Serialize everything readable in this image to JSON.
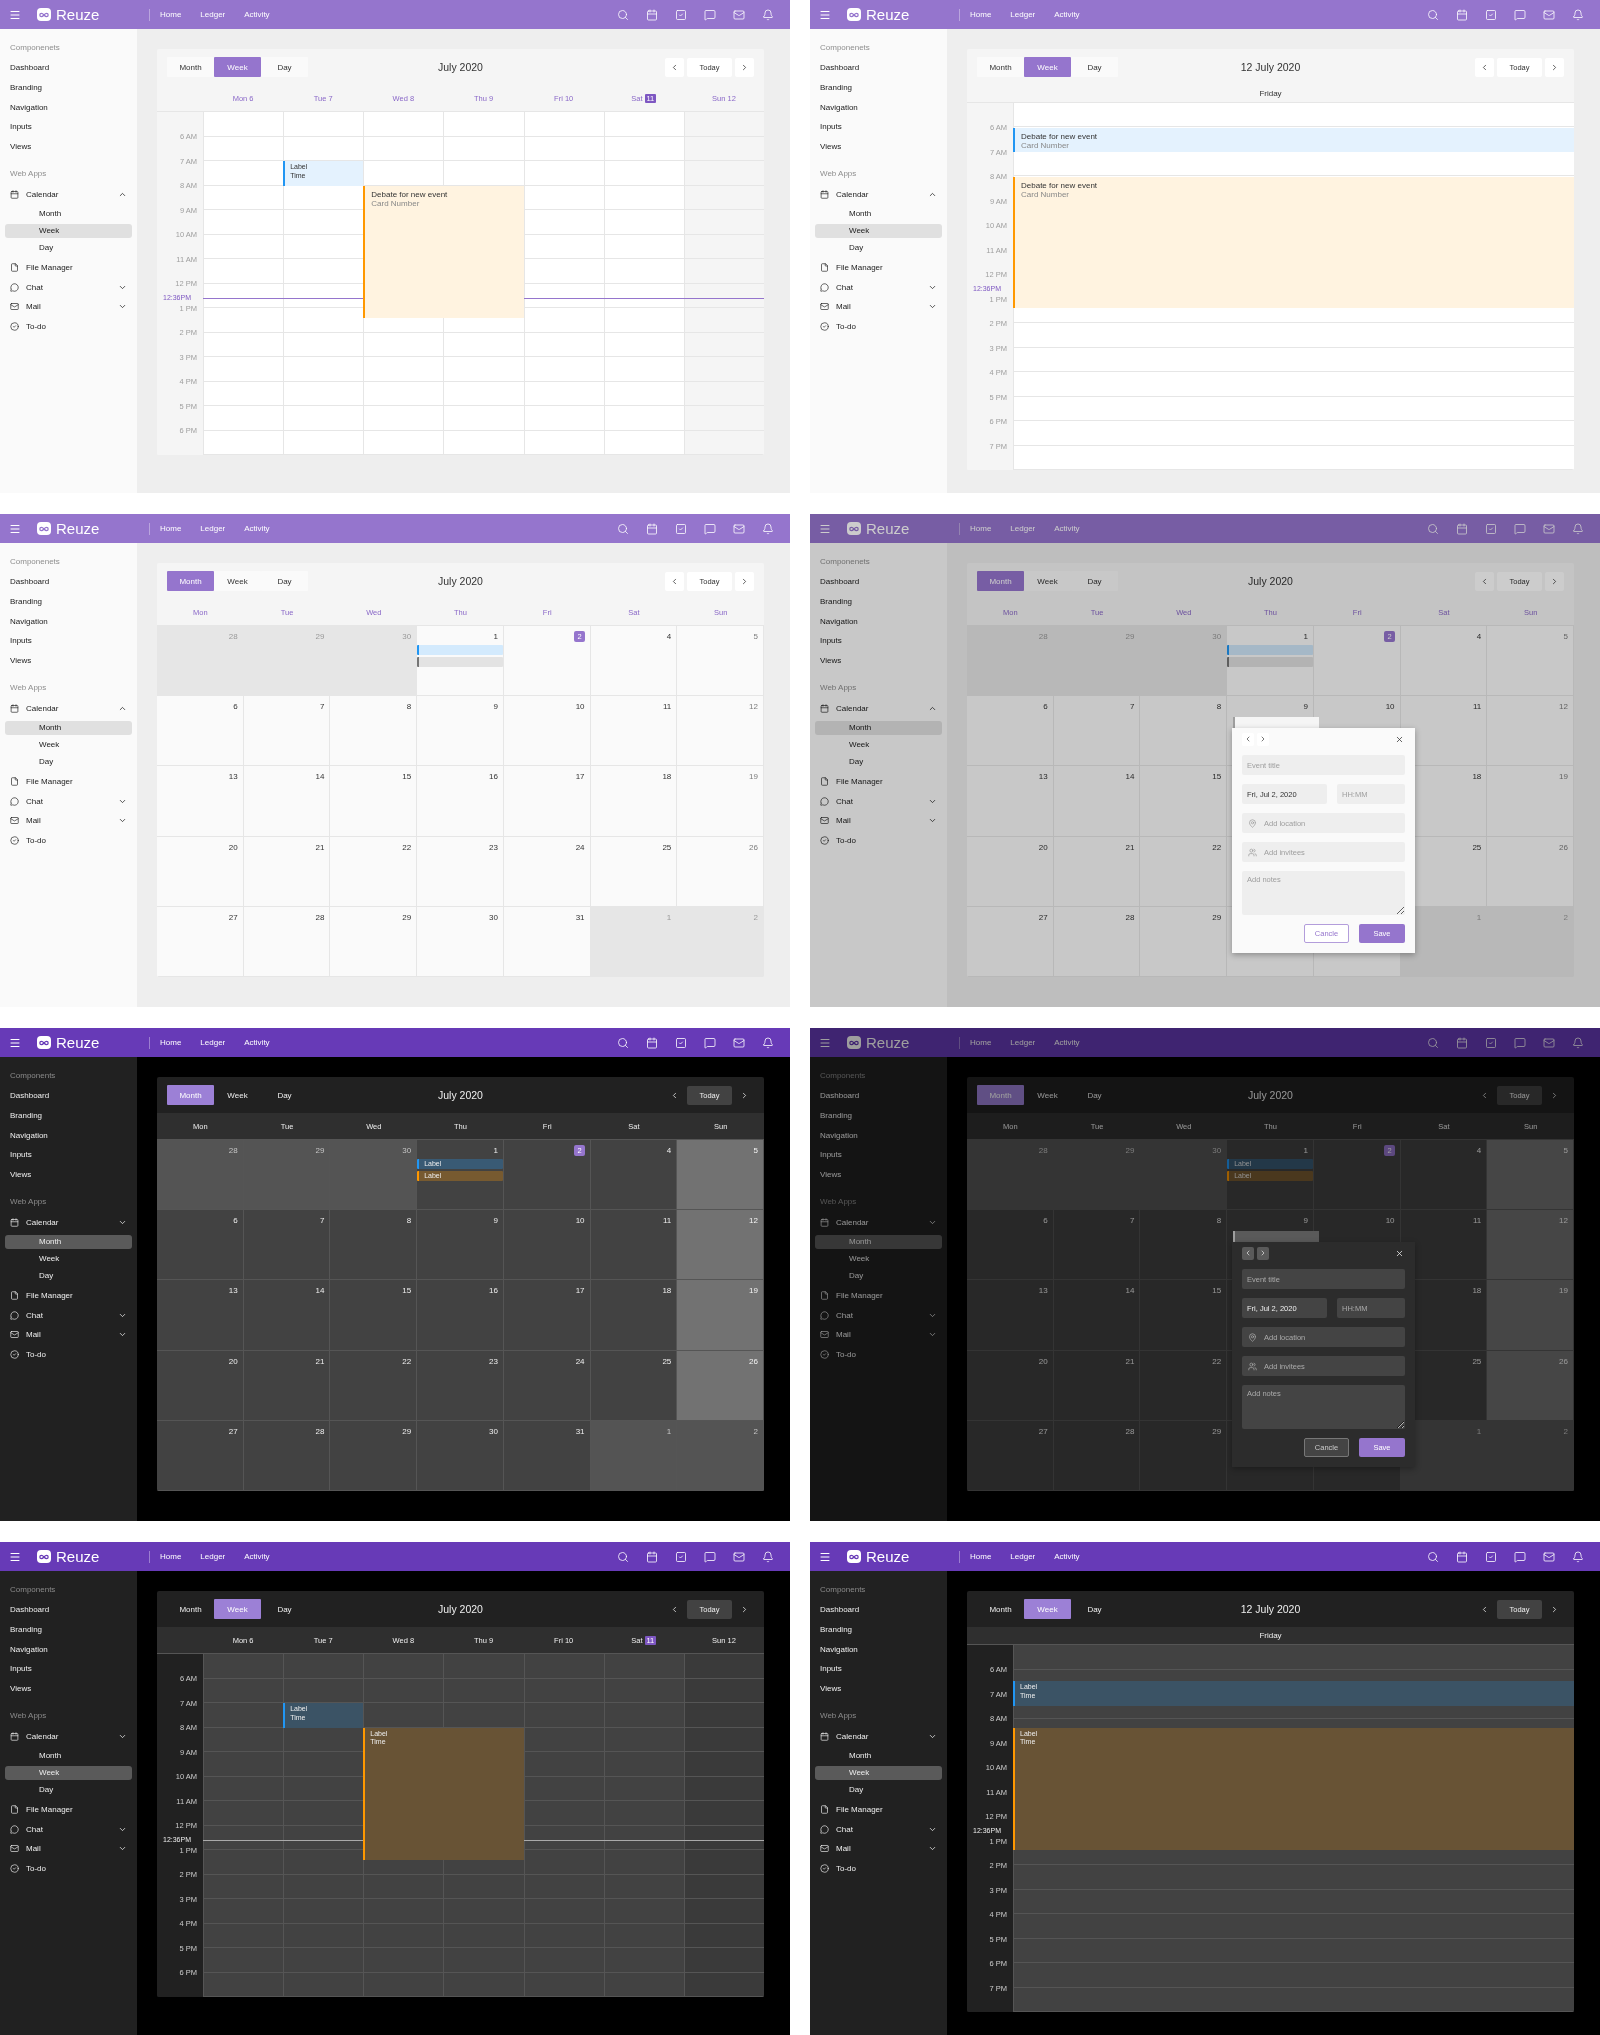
{
  "screens": [
    {
      "dark": false,
      "dimmed": false,
      "kind": "week",
      "topbar": {
        "brand": "Reuze",
        "links": [
          "Home",
          "Ledger",
          "Activity"
        ]
      },
      "sidebar": {
        "sections": [
          {
            "title": "Componenets",
            "items": [
              {
                "label": "Dashboard"
              },
              {
                "label": "Branding"
              },
              {
                "label": "Navigation"
              },
              {
                "label": "Inputs"
              },
              {
                "label": "Views"
              }
            ]
          },
          {
            "title": "Web Apps",
            "items": [
              {
                "label": "Calendar",
                "expanded": true,
                "children": [
                  {
                    "label": "Month",
                    "selected": false
                  },
                  {
                    "label": "Week",
                    "selected": true
                  },
                  {
                    "label": "Day",
                    "selected": false
                  }
                ]
              },
              {
                "label": "File Manager"
              },
              {
                "label": "Chat",
                "expanded": false
              },
              {
                "label": "Mail",
                "expanded": false
              },
              {
                "label": "To-do"
              }
            ]
          }
        ]
      },
      "toolbar": {
        "views": [
          {
            "label": "Month",
            "selected": false
          },
          {
            "label": "Week",
            "selected": true
          },
          {
            "label": "Day",
            "selected": false
          }
        ],
        "title": "July 2020",
        "today": "Today"
      },
      "days": [
        {
          "label": "Mon 6"
        },
        {
          "label": "Tue 7"
        },
        {
          "label": "Wed 8"
        },
        {
          "label": "Thu 9"
        },
        {
          "label": "Fri 10"
        },
        {
          "label": "Sat",
          "badge": "11"
        },
        {
          "label": "Sun 12"
        }
      ],
      "hours": [
        "6 AM",
        "7 AM",
        "8 AM",
        "9 AM",
        "10 AM",
        "11 AM",
        "12 PM",
        "1 PM",
        "2 PM",
        "3 PM",
        "4 PM",
        "5 PM",
        "6 PM"
      ],
      "now_label": "12:36PM",
      "events": [
        {
          "title": "Label",
          "subtitle": "Time",
          "color": "#2196f3"
        },
        {
          "title": "Debate for new event",
          "subtitle": "Card Number",
          "color": "#ff9800"
        }
      ]
    },
    {
      "dark": false,
      "dimmed": false,
      "kind": "day",
      "topbar": {
        "brand": "Reuze",
        "links": [
          "Home",
          "Ledger",
          "Activity"
        ]
      },
      "sidebar": {
        "sections": [
          {
            "title": "Componenets",
            "items": [
              {
                "label": "Dashboard"
              },
              {
                "label": "Branding"
              },
              {
                "label": "Navigation"
              },
              {
                "label": "Inputs"
              },
              {
                "label": "Views"
              }
            ]
          },
          {
            "title": "Web Apps",
            "items": [
              {
                "label": "Calendar",
                "expanded": true,
                "children": [
                  {
                    "label": "Month",
                    "selected": false
                  },
                  {
                    "label": "Week",
                    "selected": true
                  },
                  {
                    "label": "Day",
                    "selected": false
                  }
                ]
              },
              {
                "label": "File Manager"
              },
              {
                "label": "Chat",
                "expanded": false
              },
              {
                "label": "Mail",
                "expanded": false
              },
              {
                "label": "To-do"
              }
            ]
          }
        ]
      },
      "toolbar": {
        "views": [
          {
            "label": "Month",
            "selected": false
          },
          {
            "label": "Week",
            "selected": true
          },
          {
            "label": "Day",
            "selected": false
          }
        ],
        "title": "12 July 2020",
        "today": "Today"
      },
      "day_name": "Friday",
      "hours": [
        "6 AM",
        "7 AM",
        "8 AM",
        "9 AM",
        "10 AM",
        "11 AM",
        "12 PM",
        "1 PM",
        "2 PM",
        "3 PM",
        "4 PM",
        "5 PM",
        "6 PM",
        "7 PM"
      ],
      "now_label": "12:36PM",
      "events": [
        {
          "title": "Debate for new event",
          "subtitle": "Card Number",
          "color": "#2196f3"
        },
        {
          "title": "Debate for new event",
          "subtitle": "Card Number",
          "color": "#ff9800"
        }
      ]
    },
    {
      "dark": false,
      "dimmed": false,
      "kind": "month",
      "topbar": {
        "brand": "Reuze",
        "links": [
          "Home",
          "Ledger",
          "Activity"
        ]
      },
      "sidebar": {
        "sections": [
          {
            "title": "Componenets",
            "items": [
              {
                "label": "Dashboard"
              },
              {
                "label": "Branding"
              },
              {
                "label": "Navigation"
              },
              {
                "label": "Inputs"
              },
              {
                "label": "Views"
              }
            ]
          },
          {
            "title": "Web Apps",
            "items": [
              {
                "label": "Calendar",
                "expanded": true,
                "children": [
                  {
                    "label": "Month",
                    "selected": true
                  },
                  {
                    "label": "Week",
                    "selected": false
                  },
                  {
                    "label": "Day",
                    "selected": false
                  }
                ]
              },
              {
                "label": "File Manager"
              },
              {
                "label": "Chat",
                "expanded": false
              },
              {
                "label": "Mail",
                "expanded": false
              },
              {
                "label": "To-do"
              }
            ]
          }
        ]
      },
      "toolbar": {
        "views": [
          {
            "label": "Month",
            "selected": true
          },
          {
            "label": "Week",
            "selected": false
          },
          {
            "label": "Day",
            "selected": false
          }
        ],
        "title": "July 2020",
        "today": "Today"
      },
      "weekdays": [
        "Mon",
        "Tue",
        "Wed",
        "Thu",
        "Fri",
        "Sat",
        "Sun"
      ],
      "weeks": [
        [
          {
            "day": "28",
            "outside": true
          },
          {
            "day": "29",
            "outside": true
          },
          {
            "day": "30",
            "outside": true
          },
          {
            "day": "1",
            "outside": false,
            "events": [
              {
                "color": "#2196f3"
              },
              {
                "color": "#757575"
              }
            ]
          },
          {
            "day": "2",
            "outside": false,
            "today": true
          },
          {
            "day": "4",
            "outside": false
          },
          {
            "day": "5",
            "outside": false
          }
        ],
        [
          {
            "day": "6",
            "outside": false
          },
          {
            "day": "7",
            "outside": false
          },
          {
            "day": "8",
            "outside": false
          },
          {
            "day": "9",
            "outside": false
          },
          {
            "day": "10",
            "outside": false
          },
          {
            "day": "11",
            "outside": false
          },
          {
            "day": "12",
            "outside": false
          }
        ],
        [
          {
            "day": "13",
            "outside": false
          },
          {
            "day": "14",
            "outside": false
          },
          {
            "day": "15",
            "outside": false
          },
          {
            "day": "16",
            "outside": false
          },
          {
            "day": "17",
            "outside": false
          },
          {
            "day": "18",
            "outside": false
          },
          {
            "day": "19",
            "outside": false
          }
        ],
        [
          {
            "day": "20",
            "outside": false
          },
          {
            "day": "21",
            "outside": false
          },
          {
            "day": "22",
            "outside": false
          },
          {
            "day": "23",
            "outside": false
          },
          {
            "day": "24",
            "outside": false
          },
          {
            "day": "25",
            "outside": false
          },
          {
            "day": "26",
            "outside": false
          }
        ],
        [
          {
            "day": "27",
            "outside": false
          },
          {
            "day": "28",
            "outside": false
          },
          {
            "day": "29",
            "outside": false
          },
          {
            "day": "30",
            "outside": false
          },
          {
            "day": "31",
            "outside": false
          },
          {
            "day": "1",
            "outside": true
          },
          {
            "day": "2",
            "outside": true
          }
        ]
      ]
    },
    {
      "dark": false,
      "dimmed": true,
      "kind": "month",
      "topbar": {
        "brand": "Reuze",
        "links": [
          "Home",
          "Ledger",
          "Activity"
        ]
      },
      "sidebar": {
        "sections": [
          {
            "title": "Componenets",
            "items": [
              {
                "label": "Dashboard"
              },
              {
                "label": "Branding"
              },
              {
                "label": "Navigation"
              },
              {
                "label": "Inputs"
              },
              {
                "label": "Views"
              }
            ]
          },
          {
            "title": "Web Apps",
            "items": [
              {
                "label": "Calendar",
                "expanded": true,
                "children": [
                  {
                    "label": "Month",
                    "selected": true
                  },
                  {
                    "label": "Week",
                    "selected": false
                  },
                  {
                    "label": "Day",
                    "selected": false
                  }
                ]
              },
              {
                "label": "File Manager"
              },
              {
                "label": "Chat",
                "expanded": false
              },
              {
                "label": "Mail",
                "expanded": false
              },
              {
                "label": "To-do"
              }
            ]
          }
        ]
      },
      "toolbar": {
        "views": [
          {
            "label": "Month",
            "selected": true
          },
          {
            "label": "Week",
            "selected": false
          },
          {
            "label": "Day",
            "selected": false
          }
        ],
        "title": "July 2020",
        "today": "Today"
      },
      "weekdays": [
        "Mon",
        "Tue",
        "Wed",
        "Thu",
        "Fri",
        "Sat",
        "Sun"
      ],
      "weeks": [
        [
          {
            "day": "28",
            "outside": true
          },
          {
            "day": "29",
            "outside": true
          },
          {
            "day": "30",
            "outside": true
          },
          {
            "day": "1",
            "outside": false,
            "events": [
              {
                "color": "#1a78c2"
              },
              {
                "color": "#5e5e5e"
              }
            ]
          },
          {
            "day": "2",
            "outside": false,
            "today": true
          },
          {
            "day": "4",
            "outside": false
          },
          {
            "day": "5",
            "outside": false
          }
        ],
        [
          {
            "day": "6",
            "outside": false
          },
          {
            "day": "7",
            "outside": false
          },
          {
            "day": "8",
            "outside": false
          },
          {
            "day": "9",
            "outside": false
          },
          {
            "day": "10",
            "outside": false
          },
          {
            "day": "11",
            "outside": false
          },
          {
            "day": "12",
            "outside": false
          }
        ],
        [
          {
            "day": "13",
            "outside": false
          },
          {
            "day": "14",
            "outside": false
          },
          {
            "day": "15",
            "outside": false
          },
          {
            "day": "18",
            "outside": false
          },
          {
            "day": "19",
            "outside": false
          }
        ],
        [
          {
            "day": "20",
            "outside": false
          },
          {
            "day": "21",
            "outside": false
          },
          {
            "day": "22",
            "outside": false
          },
          {
            "day": "25",
            "outside": false
          },
          {
            "day": "26",
            "outside": false
          }
        ],
        [
          {
            "day": "27",
            "outside": false
          },
          {
            "day": "28",
            "outside": false
          },
          {
            "day": "29",
            "outside": false
          },
          {
            "outside": false
          },
          {
            "outside": false
          },
          {
            "day": "1",
            "outside": true
          },
          {
            "day": "2",
            "outside": true
          }
        ]
      ],
      "modal": {
        "title_placeholder": "Event title",
        "date": "Fri, Jul 2, 2020",
        "time_placeholder": "HH:MM",
        "location_placeholder": "Add location",
        "invitees_placeholder": "Add invitees",
        "notes_placeholder": "Add notes",
        "cancel": "Cancle",
        "save": "Save"
      }
    },
    {
      "dark": true,
      "dimmed": false,
      "kind": "month",
      "topbar": {
        "brand": "Reuze",
        "links": [
          "Home",
          "Ledger",
          "Activity"
        ]
      },
      "sidebar": {
        "sections": [
          {
            "title": "Components",
            "items": [
              {
                "label": "Dashboard"
              },
              {
                "label": "Branding"
              },
              {
                "label": "Navigation"
              },
              {
                "label": "Inputs"
              },
              {
                "label": "Views"
              }
            ]
          },
          {
            "title": "Web Apps",
            "items": [
              {
                "label": "Calendar",
                "expanded": false,
                "children": [
                  {
                    "label": "Month",
                    "selected": true
                  },
                  {
                    "label": "Week",
                    "selected": false
                  },
                  {
                    "label": "Day",
                    "selected": false
                  }
                ]
              },
              {
                "label": "File Manager"
              },
              {
                "label": "Chat",
                "expanded": false
              },
              {
                "label": "Mail",
                "expanded": false
              },
              {
                "label": "To-do"
              }
            ]
          }
        ]
      },
      "toolbar": {
        "views": [
          {
            "label": "Month",
            "selected": true
          },
          {
            "label": "Week",
            "selected": false
          },
          {
            "label": "Day",
            "selected": false
          }
        ],
        "title": "July 2020",
        "today": "Today"
      },
      "weekdays": [
        "Mon",
        "Tue",
        "Wed",
        "Thu",
        "Fri",
        "Sat",
        "Sun"
      ],
      "weeks": [
        [
          {
            "day": "28",
            "outside": true
          },
          {
            "day": "29",
            "outside": true
          },
          {
            "day": "30",
            "outside": true
          },
          {
            "day": "1",
            "outside": false,
            "events": [
              {
                "label": "Label",
                "color": "#2196f3"
              },
              {
                "label": "Label",
                "color": "#ff9800"
              }
            ]
          },
          {
            "day": "2",
            "outside": false,
            "today": true
          },
          {
            "day": "4",
            "outside": false
          },
          {
            "day": "5",
            "outside": false
          }
        ],
        [
          {
            "day": "6",
            "outside": false
          },
          {
            "day": "7",
            "outside": false
          },
          {
            "day": "8",
            "outside": false
          },
          {
            "day": "9",
            "outside": false
          },
          {
            "day": "10",
            "outside": false
          },
          {
            "day": "11",
            "outside": false
          },
          {
            "day": "12",
            "outside": false
          }
        ],
        [
          {
            "day": "13",
            "outside": false
          },
          {
            "day": "14",
            "outside": false
          },
          {
            "day": "15",
            "outside": false
          },
          {
            "day": "16",
            "outside": false
          },
          {
            "day": "17",
            "outside": false
          },
          {
            "day": "18",
            "outside": false
          },
          {
            "day": "19",
            "outside": false
          }
        ],
        [
          {
            "day": "20",
            "outside": false
          },
          {
            "day": "21",
            "outside": false
          },
          {
            "day": "22",
            "outside": false
          },
          {
            "day": "23",
            "outside": false
          },
          {
            "day": "24",
            "outside": false
          },
          {
            "day": "25",
            "outside": false
          },
          {
            "day": "26",
            "outside": false
          }
        ],
        [
          {
            "day": "27",
            "outside": false
          },
          {
            "day": "28",
            "outside": false
          },
          {
            "day": "29",
            "outside": false
          },
          {
            "day": "30",
            "outside": false
          },
          {
            "day": "31",
            "outside": false
          },
          {
            "day": "1",
            "outside": true
          },
          {
            "day": "2",
            "outside": true
          }
        ]
      ]
    },
    {
      "dark": true,
      "dimmed": true,
      "kind": "month",
      "topbar": {
        "brand": "Reuze",
        "links": [
          "Home",
          "Ledger",
          "Activity"
        ]
      },
      "sidebar": {
        "sections": [
          {
            "title": "Components",
            "items": [
              {
                "label": "Dashboard"
              },
              {
                "label": "Branding"
              },
              {
                "label": "Navigation"
              },
              {
                "label": "Inputs"
              },
              {
                "label": "Views"
              }
            ]
          },
          {
            "title": "Web Apps",
            "items": [
              {
                "label": "Calendar",
                "expanded": false,
                "children": [
                  {
                    "label": "Month",
                    "selected": true
                  },
                  {
                    "label": "Week",
                    "selected": false
                  },
                  {
                    "label": "Day",
                    "selected": false
                  }
                ]
              },
              {
                "label": "File Manager"
              },
              {
                "label": "Chat",
                "expanded": false
              },
              {
                "label": "Mail",
                "expanded": false
              },
              {
                "label": "To-do"
              }
            ]
          }
        ]
      },
      "toolbar": {
        "views": [
          {
            "label": "Month",
            "selected": true
          },
          {
            "label": "Week",
            "selected": false
          },
          {
            "label": "Day",
            "selected": false
          }
        ],
        "title": "July 2020",
        "today": "Today"
      },
      "weekdays": [
        "Mon",
        "Tue",
        "Wed",
        "Thu",
        "Fri",
        "Sat",
        "Sun"
      ],
      "weeks": [
        [
          {
            "day": "28",
            "outside": true
          },
          {
            "day": "29",
            "outside": true
          },
          {
            "day": "30",
            "outside": true
          },
          {
            "day": "1",
            "outside": false,
            "events": [
              {
                "label": "Label",
                "color": "#145d97"
              },
              {
                "label": "Label",
                "color": "#9e5e00"
              }
            ]
          },
          {
            "day": "2",
            "outside": false,
            "today": true
          },
          {
            "day": "4",
            "outside": false
          },
          {
            "day": "5",
            "outside": false
          }
        ],
        [
          {
            "day": "6",
            "outside": false
          },
          {
            "day": "7",
            "outside": false
          },
          {
            "day": "8",
            "outside": false
          },
          {
            "day": "9",
            "outside": false
          },
          {
            "day": "10",
            "outside": false
          },
          {
            "day": "11",
            "outside": false
          },
          {
            "day": "12",
            "outside": false
          }
        ],
        [
          {
            "day": "13",
            "outside": false
          },
          {
            "day": "14",
            "outside": false
          },
          {
            "day": "15",
            "outside": false
          },
          {
            "day": "18",
            "outside": false
          },
          {
            "day": "19",
            "outside": false
          }
        ],
        [
          {
            "day": "20",
            "outside": false
          },
          {
            "day": "21",
            "outside": false
          },
          {
            "day": "22",
            "outside": false
          },
          {
            "day": "25",
            "outside": false
          },
          {
            "day": "26",
            "outside": false
          }
        ],
        [
          {
            "day": "27",
            "outside": false
          },
          {
            "day": "28",
            "outside": false
          },
          {
            "day": "29",
            "outside": false
          },
          {
            "outside": false
          },
          {
            "outside": false
          },
          {
            "day": "1",
            "outside": true
          },
          {
            "day": "2",
            "outside": true
          }
        ]
      ],
      "modal": {
        "title_placeholder": "Event title",
        "date": "Fri, Jul 2, 2020",
        "time_placeholder": "HH:MM",
        "location_placeholder": "Add location",
        "invitees_placeholder": "Add invitees",
        "notes_placeholder": "Add notes",
        "cancel": "Cancle",
        "save": "Save"
      }
    },
    {
      "dark": true,
      "dimmed": false,
      "kind": "week",
      "topbar": {
        "brand": "Reuze",
        "links": [
          "Home",
          "Ledger",
          "Activity"
        ]
      },
      "sidebar": {
        "sections": [
          {
            "title": "Components",
            "items": [
              {
                "label": "Dashboard"
              },
              {
                "label": "Branding"
              },
              {
                "label": "Navigation"
              },
              {
                "label": "Inputs"
              },
              {
                "label": "Views"
              }
            ]
          },
          {
            "title": "Web Apps",
            "items": [
              {
                "label": "Calendar",
                "expanded": false,
                "children": [
                  {
                    "label": "Month",
                    "selected": false
                  },
                  {
                    "label": "Week",
                    "selected": true
                  },
                  {
                    "label": "Day",
                    "selected": false
                  }
                ]
              },
              {
                "label": "File Manager"
              },
              {
                "label": "Chat",
                "expanded": false
              },
              {
                "label": "Mail",
                "expanded": false
              },
              {
                "label": "To-do"
              }
            ]
          }
        ]
      },
      "toolbar": {
        "views": [
          {
            "label": "Month",
            "selected": false
          },
          {
            "label": "Week",
            "selected": true
          },
          {
            "label": "Day",
            "selected": false
          }
        ],
        "title": "July 2020",
        "today": "Today"
      },
      "days": [
        {
          "label": "Mon 6"
        },
        {
          "label": "Tue 7"
        },
        {
          "label": "Wed 8"
        },
        {
          "label": "Thu 9"
        },
        {
          "label": "Fri 10"
        },
        {
          "label": "Sat",
          "badge": "11"
        },
        {
          "label": "Sun 12"
        }
      ],
      "hours": [
        "6 AM",
        "7 AM",
        "8 AM",
        "9 AM",
        "10 AM",
        "11 AM",
        "12 PM",
        "1 PM",
        "2 PM",
        "3 PM",
        "4 PM",
        "5 PM",
        "6 PM"
      ],
      "now_label": "12:36PM",
      "events": [
        {
          "title": "Label",
          "subtitle": "Time",
          "color": "#2196f3"
        },
        {
          "title": "Label",
          "subtitle": "Time",
          "color": "#ff9800"
        }
      ]
    },
    {
      "dark": true,
      "dimmed": false,
      "kind": "day",
      "topbar": {
        "brand": "Reuze",
        "links": [
          "Home",
          "Ledger",
          "Activity"
        ]
      },
      "sidebar": {
        "sections": [
          {
            "title": "Components",
            "items": [
              {
                "label": "Dashboard"
              },
              {
                "label": "Branding"
              },
              {
                "label": "Navigation"
              },
              {
                "label": "Inputs"
              },
              {
                "label": "Views"
              }
            ]
          },
          {
            "title": "Web Apps",
            "items": [
              {
                "label": "Calendar",
                "expanded": false,
                "children": [
                  {
                    "label": "Month",
                    "selected": false
                  },
                  {
                    "label": "Week",
                    "selected": true
                  },
                  {
                    "label": "Day",
                    "selected": false
                  }
                ]
              },
              {
                "label": "File Manager"
              },
              {
                "label": "Chat",
                "expanded": false
              },
              {
                "label": "Mail",
                "expanded": false
              },
              {
                "label": "To-do"
              }
            ]
          }
        ]
      },
      "toolbar": {
        "views": [
          {
            "label": "Month",
            "selected": false
          },
          {
            "label": "Week",
            "selected": true
          },
          {
            "label": "Day",
            "selected": false
          }
        ],
        "title": "12 July 2020",
        "today": "Today"
      },
      "day_name": "Friday",
      "hours": [
        "6 AM",
        "7 AM",
        "8 AM",
        "9 AM",
        "10 AM",
        "11 AM",
        "12 PM",
        "1 PM",
        "2 PM",
        "3 PM",
        "4 PM",
        "5 PM",
        "6 PM",
        "7 PM"
      ],
      "now_label": "12:36PM",
      "events": [
        {
          "title": "Label",
          "subtitle": "Time",
          "color": "#2196f3"
        },
        {
          "title": "Label",
          "subtitle": "Time",
          "color": "#ff9800"
        }
      ]
    }
  ]
}
